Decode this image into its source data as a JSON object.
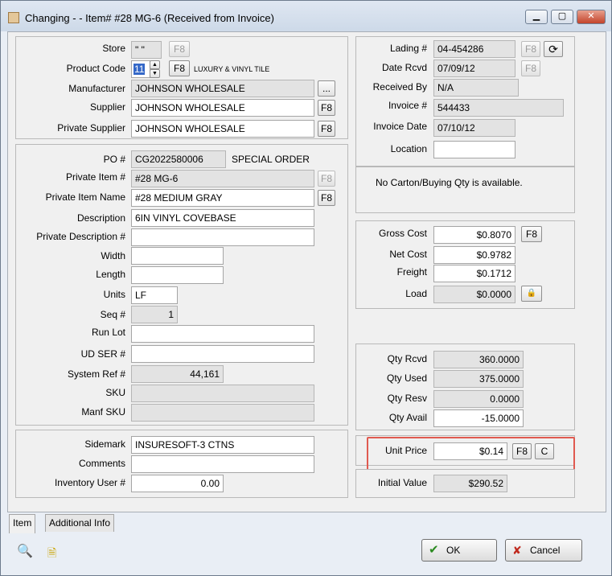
{
  "window": {
    "title": "Changing - - Item# #28 MG-6  (Received from Invoice)",
    "minimize_glyph": "▁",
    "maximize_glyph": "▢",
    "close_glyph": "✕"
  },
  "left": {
    "store_label": "Store",
    "store_value": "\" \"",
    "product_code_label": "Product Code",
    "product_code_value": "11",
    "product_code_desc": "LUXURY & VINYL TILE",
    "manufacturer_label": "Manufacturer",
    "manufacturer_value": "JOHNSON WHOLESALE",
    "supplier_label": "Supplier",
    "supplier_value": "JOHNSON WHOLESALE",
    "private_supplier_label": "Private Supplier",
    "private_supplier_value": "JOHNSON WHOLESALE",
    "po_label": "PO #",
    "po_value": "CG2022580006",
    "po_note": "SPECIAL ORDER",
    "private_item_label": "Private Item #",
    "private_item_value": "#28 MG-6",
    "private_item_name_label": "Private Item Name",
    "private_item_name_value": "#28 MEDIUM GRAY",
    "description_label": "Description",
    "description_value": "6IN VINYL COVEBASE",
    "private_description_label": "Private Description #",
    "private_description_value": "",
    "width_label": "Width",
    "width_value": "",
    "length_label": "Length",
    "length_value": "",
    "units_label": "Units",
    "units_value": "LF",
    "seq_label": "Seq #",
    "seq_value": "1",
    "run_lot_label": "Run Lot",
    "run_lot_value": "",
    "ud_ser_label": "UD SER #",
    "ud_ser_value": "",
    "system_ref_label": "System Ref #",
    "system_ref_value": "44,161",
    "sku_label": "SKU",
    "sku_value": "",
    "manf_sku_label": "Manf SKU",
    "manf_sku_value": "",
    "sidemark_label": "Sidemark",
    "sidemark_value": "INSURESOFT-3 CTNS",
    "comments_label": "Comments",
    "comments_value": "",
    "inventory_user_label": "Inventory User #",
    "inventory_user_value": "0.00"
  },
  "right": {
    "lading_label": "Lading #",
    "lading_value": "04-454286",
    "date_rcvd_label": "Date Rcvd",
    "date_rcvd_value": "07/09/12",
    "received_by_label": "Received By",
    "received_by_value": "N/A",
    "invoice_label": "Invoice #",
    "invoice_value": "544433",
    "invoice_date_label": "Invoice Date",
    "invoice_date_value": "07/10/12",
    "location_label": "Location",
    "location_value": "",
    "carton_message": "No Carton/Buying Qty is available.",
    "gross_cost_label": "Gross Cost",
    "gross_cost_value": "$0.8070",
    "net_cost_label": "Net Cost",
    "net_cost_value": "$0.9782",
    "freight_label": "Freight",
    "freight_value": "$0.1712",
    "load_label": "Load",
    "load_value": "$0.0000",
    "qty_rcvd_label": "Qty Rcvd",
    "qty_rcvd_value": "360.0000",
    "qty_used_label": "Qty Used",
    "qty_used_value": "375.0000",
    "qty_resv_label": "Qty Resv",
    "qty_resv_value": "0.0000",
    "qty_avail_label": "Qty Avail",
    "qty_avail_value": "-15.0000",
    "unit_price_label": "Unit Price",
    "unit_price_value": "$0.14",
    "initial_value_label": "Initial Value",
    "initial_value_value": "$290.52"
  },
  "buttons": {
    "f8": "F8",
    "ellipsis": "...",
    "c": "C",
    "spin_up": "▲",
    "spin_down": "▼",
    "lock_glyph": "🔒",
    "refresh_glyph": "⟳",
    "ok_label": "OK",
    "ok_glyph": "✔",
    "cancel_label": "Cancel",
    "cancel_glyph": "✘",
    "search_glyph": "🔍",
    "note_glyph": "🗎"
  },
  "tabs": [
    {
      "label": "Item"
    },
    {
      "label": "Additional Info"
    }
  ],
  "colors": {
    "highlight_border": "#e05a50",
    "ok_check": "#2a8a1f",
    "cancel_x": "#c0291d"
  }
}
